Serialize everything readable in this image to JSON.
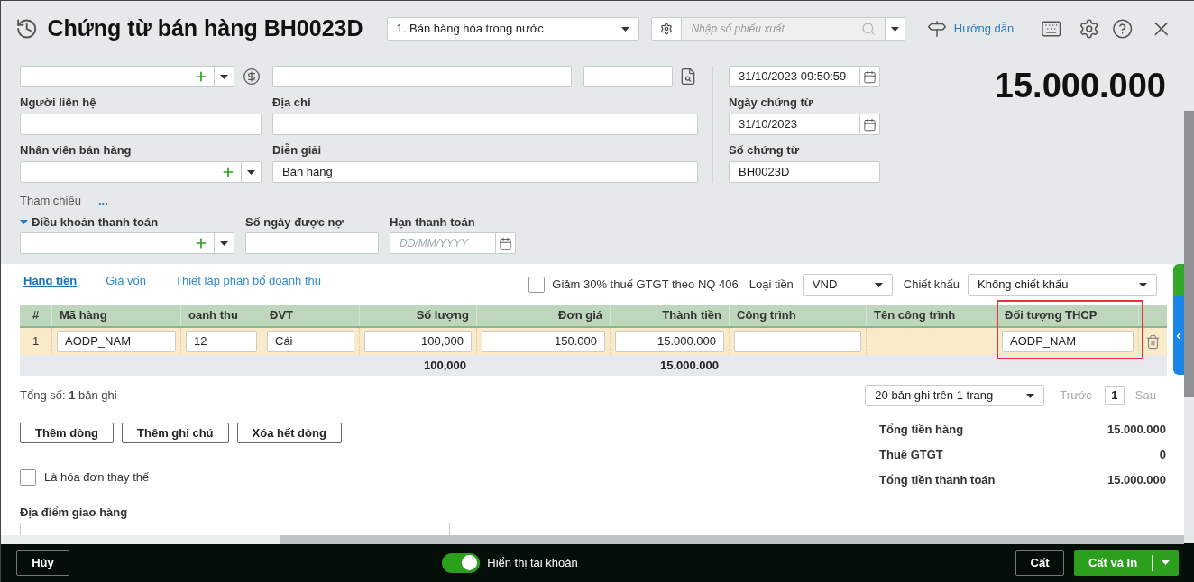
{
  "header": {
    "title": "Chứng từ bán hàng BH0023D",
    "transaction_type": "1. Bán hàng hóa trong nước",
    "search": {
      "placeholder": "Nhập số phiếu xuất"
    },
    "guide_link": "Hướng dẫn"
  },
  "form": {
    "contact_label": "Người liên hệ",
    "address_label": "Địa chỉ",
    "salesperson_label": "Nhân viên bán hàng",
    "description": {
      "label": "Diễn giải",
      "value": "Bán hàng"
    },
    "reference": {
      "label": "Tham chiếu",
      "link": "..."
    },
    "payment_terms": {
      "label": "Điều khoản thanh toán",
      "expanded": true
    },
    "credit_days_label": "Số ngày được nợ",
    "due_date": {
      "label": "Hạn thanh toán",
      "placeholder": "DD/MM/YYYY"
    }
  },
  "dates": {
    "posting_datetime": "31/10/2023 09:50:59",
    "voucher_date": {
      "label": "Ngày chứng từ",
      "value": "31/10/2023"
    },
    "voucher_no": {
      "label": "Số chứng từ",
      "value": "BH0023D"
    }
  },
  "total_amount": "15.000.000",
  "detail": {
    "tabs": [
      {
        "label": "Hàng tiền",
        "selected": true
      },
      {
        "label": "Giá vốn",
        "selected": false
      },
      {
        "label": "Thiết lập phân bổ doanh thu",
        "selected": false
      }
    ],
    "vat_reduction": {
      "label": "Giảm 30% thuế GTGT theo NQ 406",
      "checked": false
    },
    "currency": {
      "label": "Loại tiền",
      "value": "VND"
    },
    "discount": {
      "label": "Chiết khấu",
      "value": "Không chiết khấu"
    },
    "table": {
      "columns": [
        {
          "label": "#",
          "highlighted": false
        },
        {
          "label": "Mã hàng",
          "highlighted": false
        },
        {
          "label": "oanh thu",
          "highlighted": false
        },
        {
          "label": "ĐVT",
          "highlighted": false
        },
        {
          "label": "Số lượng",
          "highlighted": false,
          "total": "100,000"
        },
        {
          "label": "Đơn giá",
          "highlighted": false
        },
        {
          "label": "Thành tiền",
          "highlighted": false,
          "total": "15.000.000"
        },
        {
          "label": "Công trình",
          "highlighted": false
        },
        {
          "label": "Tên công trình",
          "highlighted": false
        },
        {
          "label": "Đối tượng THCP",
          "highlighted": true
        }
      ],
      "rows": [
        {
          "cells": [
            {
              "kind": "text",
              "value": "1"
            },
            {
              "kind": "input",
              "value": "AODP_NAM"
            },
            {
              "kind": "input",
              "value": "12"
            },
            {
              "kind": "input",
              "value": "Cái"
            },
            {
              "kind": "input",
              "value": "100,000"
            },
            {
              "kind": "input",
              "value": "150.000"
            },
            {
              "kind": "input",
              "value": "15.000.000"
            },
            {
              "kind": "input"
            },
            {
              "kind": "blank"
            },
            {
              "kind": "input",
              "value": "AODP_NAM"
            }
          ]
        }
      ]
    },
    "record_count": "Tổng số: **1** bản ghi",
    "pager": {
      "page_size": "20 bản ghi trên 1 trang",
      "previous": {
        "label": "Trước",
        "disabled": true
      },
      "page": "1",
      "next": {
        "label": "Sau",
        "disabled": true
      }
    },
    "buttons": [
      "Thêm dòng",
      "Thêm ghi chú",
      "Xóa hết dòng"
    ],
    "replacement_invoice": {
      "label": "Là hóa đơn thay thế",
      "checked": false
    },
    "delivery_place_label": "Địa điểm giao hàng",
    "summary": [
      {
        "label": "Tổng tiền hàng",
        "value": "15.000.000"
      },
      {
        "label": "Thuế GTGT",
        "value": "0"
      },
      {
        "label": "Tổng tiền thanh toán",
        "value": "15.000.000"
      }
    ]
  },
  "footer": {
    "cancel": "Hủy",
    "show_accounts": {
      "label": "Hiển thị tài khoản",
      "on": true
    },
    "save": "Cất",
    "save_print": "Cất và In"
  }
}
